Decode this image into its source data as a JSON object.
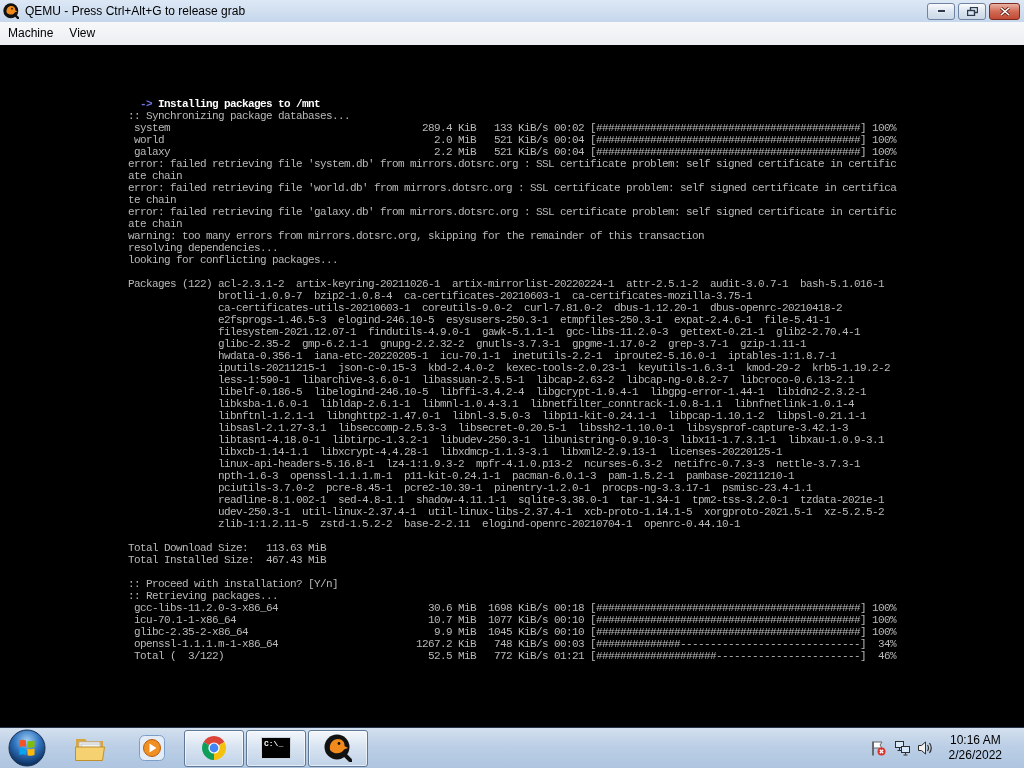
{
  "window": {
    "title": "QEMU - Press Ctrl+Alt+G to release grab"
  },
  "menu": [
    "Machine",
    "View"
  ],
  "console": {
    "blocks": [
      {
        "kind": "lines",
        "lines": [
          {
            "kind": "step",
            "marker": "->",
            "text": "Installing packages to /mnt"
          },
          {
            "kind": "plain",
            "text": ":: Synchronizing package databases..."
          },
          {
            "kind": "progress",
            "name": "system",
            "size": "289.4 KiB",
            "rate": "133 KiB/s",
            "eta": "00:02",
            "bar": "[############################################]",
            "percent": "100%"
          },
          {
            "kind": "progress",
            "name": "world",
            "size": "2.0 MiB",
            "rate": "521 KiB/s",
            "eta": "00:04",
            "bar": "[############################################]",
            "percent": "100%"
          },
          {
            "kind": "progress",
            "name": "galaxy",
            "size": "2.2 MiB",
            "rate": "521 KiB/s",
            "eta": "00:04",
            "bar": "[############################################]",
            "percent": "100%"
          },
          {
            "kind": "plain",
            "text": "error: failed retrieving file 'system.db' from mirrors.dotsrc.org : SSL certificate problem: self signed certificate in certific"
          },
          {
            "kind": "plain",
            "text": "ate chain"
          },
          {
            "kind": "plain",
            "text": "error: failed retrieving file 'world.db' from mirrors.dotsrc.org : SSL certificate problem: self signed certificate in certifica"
          },
          {
            "kind": "plain",
            "text": "te chain"
          },
          {
            "kind": "plain",
            "text": "error: failed retrieving file 'galaxy.db' from mirrors.dotsrc.org : SSL certificate problem: self signed certificate in certific"
          },
          {
            "kind": "plain",
            "text": "ate chain"
          },
          {
            "kind": "plain",
            "text": "warning: too many errors from mirrors.dotsrc.org, skipping for the remainder of this transaction"
          },
          {
            "kind": "plain",
            "text": "resolving dependencies..."
          },
          {
            "kind": "plain",
            "text": "looking for conflicting packages..."
          }
        ]
      },
      {
        "kind": "packages",
        "label": "Packages (122)",
        "lines": [
          "acl-2.3.1-2  artix-keyring-20211026-1  artix-mirrorlist-20220224-1  attr-2.5.1-2  audit-3.0.7-1  bash-5.1.016-1",
          "brotli-1.0.9-7  bzip2-1.0.8-4  ca-certificates-20210603-1  ca-certificates-mozilla-3.75-1",
          "ca-certificates-utils-20210603-1  coreutils-9.0-2  curl-7.81.0-2  dbus-1.12.20-1  dbus-openrc-20210418-2",
          "e2fsprogs-1.46.5-3  elogind-246.10-5  esysusers-250.3-1  etmpfiles-250.3-1  expat-2.4.6-1  file-5.41-1",
          "filesystem-2021.12.07-1  findutils-4.9.0-1  gawk-5.1.1-1  gcc-libs-11.2.0-3  gettext-0.21-1  glib2-2.70.4-1",
          "glibc-2.35-2  gmp-6.2.1-1  gnupg-2.2.32-2  gnutls-3.7.3-1  gpgme-1.17.0-2  grep-3.7-1  gzip-1.11-1",
          "hwdata-0.356-1  iana-etc-20220205-1  icu-70.1-1  inetutils-2.2-1  iproute2-5.16.0-1  iptables-1:1.8.7-1",
          "iputils-20211215-1  json-c-0.15-3  kbd-2.4.0-2  kexec-tools-2.0.23-1  keyutils-1.6.3-1  kmod-29-2  krb5-1.19.2-2",
          "less-1:590-1  libarchive-3.6.0-1  libassuan-2.5.5-1  libcap-2.63-2  libcap-ng-0.8.2-7  libcroco-0.6.13-2.1",
          "libelf-0.186-5  libelogind-246.10-5  libffi-3.4.2-4  libgcrypt-1.9.4-1  libgpg-error-1.44-1  libidn2-2.3.2-1",
          "libksba-1.6.0-1  libldap-2.6.1-1  libmnl-1.0.4-3.1  libnetfilter_conntrack-1.0.8-1.1  libnfnetlink-1.0.1-4",
          "libnftnl-1.2.1-1  libnghttp2-1.47.0-1  libnl-3.5.0-3  libp11-kit-0.24.1-1  libpcap-1.10.1-2  libpsl-0.21.1-1",
          "libsasl-2.1.27-3.1  libseccomp-2.5.3-3  libsecret-0.20.5-1  libssh2-1.10.0-1  libsysprof-capture-3.42.1-3",
          "libtasn1-4.18.0-1  libtirpc-1.3.2-1  libudev-250.3-1  libunistring-0.9.10-3  libx11-1.7.3.1-1  libxau-1.0.9-3.1",
          "libxcb-1.14-1.1  libxcrypt-4.4.28-1  libxdmcp-1.1.3-3.1  libxml2-2.9.13-1  licenses-20220125-1",
          "linux-api-headers-5.16.8-1  lz4-1:1.9.3-2  mpfr-4.1.0.p13-2  ncurses-6.3-2  netifrc-0.7.3-3  nettle-3.7.3-1",
          "npth-1.6-3  openssl-1.1.1.m-1  p11-kit-0.24.1-1  pacman-6.0.1-3  pam-1.5.2-1  pambase-20211210-1",
          "pciutils-3.7.0-2  pcre-8.45-1  pcre2-10.39-1  pinentry-1.2.0-1  procps-ng-3.3.17-1  psmisc-23.4-1.1",
          "readline-8.1.002-1  sed-4.8-1.1  shadow-4.11.1-1  sqlite-3.38.0-1  tar-1.34-1  tpm2-tss-3.2.0-1  tzdata-2021e-1",
          "udev-250.3-1  util-linux-2.37.4-1  util-linux-libs-2.37.4-1  xcb-proto-1.14.1-5  xorgproto-2021.5-1  xz-5.2.5-2",
          "zlib-1:1.2.11-5  zstd-1.5.2-2  base-2-2.11  elogind-openrc-20210704-1  openrc-0.44.10-1"
        ]
      },
      {
        "kind": "lines",
        "lines": [
          {
            "kind": "plain",
            "text": "Total Download Size:   113.63 MiB"
          },
          {
            "kind": "plain",
            "text": "Total Installed Size:  467.43 MiB"
          }
        ]
      },
      {
        "kind": "lines",
        "lines": [
          {
            "kind": "plain",
            "text": ":: Proceed with installation? [Y/n]"
          },
          {
            "kind": "plain",
            "text": ":: Retrieving packages..."
          },
          {
            "kind": "progress",
            "name": "gcc-libs-11.2.0-3-x86_64",
            "size": "30.6 MiB",
            "rate": "1698 KiB/s",
            "eta": "00:18",
            "bar": "[############################################]",
            "percent": "100%"
          },
          {
            "kind": "progress",
            "name": "icu-70.1-1-x86_64",
            "size": "10.7 MiB",
            "rate": "1077 KiB/s",
            "eta": "00:10",
            "bar": "[############################################]",
            "percent": "100%"
          },
          {
            "kind": "progress",
            "name": "glibc-2.35-2-x86_64",
            "size": "9.9 MiB",
            "rate": "1045 KiB/s",
            "eta": "00:10",
            "bar": "[############################################]",
            "percent": "100%"
          },
          {
            "kind": "progress",
            "name": "openssl-1.1.1.m-1-x86_64",
            "size": "1267.2 KiB",
            "rate": "748 KiB/s",
            "eta": "00:03",
            "bar": "[##############------------------------------]",
            "percent": "34%"
          },
          {
            "kind": "progress",
            "name": "Total (  3/122)",
            "size": "52.5 MiB",
            "rate": "772 KiB/s",
            "eta": "01:21",
            "bar": "[####################------------------------]",
            "percent": "46%"
          }
        ]
      }
    ]
  },
  "taskbar": {
    "apps": [
      {
        "kind": "folder",
        "running": false
      },
      {
        "kind": "player",
        "running": false
      },
      {
        "kind": "browser",
        "running": true
      },
      {
        "kind": "terminal",
        "running": true,
        "glyph": "C:\\_"
      },
      {
        "kind": "emulator",
        "running": true
      }
    ],
    "clock": {
      "time": "10:16 AM",
      "date": "2/26/2022"
    }
  }
}
